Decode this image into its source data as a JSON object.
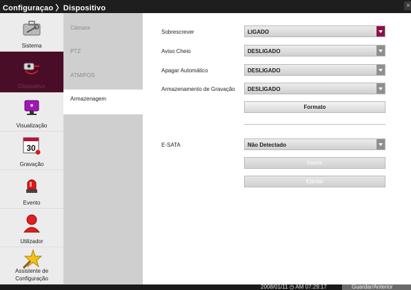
{
  "window": {
    "title": "Configuraçao 〉Dispositivo",
    "close_glyph": "×"
  },
  "sidebar": {
    "items": [
      {
        "label": "Sistema",
        "icon": "toolbox-icon"
      },
      {
        "label": "Dispositivo",
        "icon": "camera-plug-icon",
        "active": true
      },
      {
        "label": "Visualização",
        "icon": "monitor-icon"
      },
      {
        "label": "Gravação",
        "icon": "calendar-icon",
        "calendar_day": "30"
      },
      {
        "label": "Evento",
        "icon": "alarm-siren-icon"
      },
      {
        "label": "Utilizador",
        "icon": "user-icon"
      },
      {
        "label_line1": "Assistente de",
        "label_line2": "Configuração",
        "icon": "wizard-star-icon"
      }
    ]
  },
  "subnav": {
    "items": [
      {
        "label": "Câmara"
      },
      {
        "label": "PTZ"
      },
      {
        "label": "ATM/POS"
      },
      {
        "label": "Armazenagem",
        "active": true
      }
    ]
  },
  "settings": {
    "overwrite": {
      "label": "Sobrescrever",
      "value": "LIGADO"
    },
    "disk_full_warning": {
      "label": "Aviso Cheio",
      "value": "DESLIGADO"
    },
    "auto_delete": {
      "label": "Apagar Automático",
      "value": "DESLIGADO"
    },
    "recording_storage": {
      "label": "Armazenamento de Gravação",
      "value": "DESLIGADO"
    },
    "format_button": "Formato",
    "esata": {
      "label": "E-SATA",
      "value": "Não Detectado"
    },
    "insert_button": "Inserir",
    "eject_button": "Ejectar"
  },
  "statusbar": {
    "datetime": "2008/01/11 ◷ AM 07:29:17",
    "save_button": "Guardar/Anterior"
  },
  "colors": {
    "accent": "#8a1248",
    "active_sidebar_bg": "#4a0d28",
    "titlebar_bg": "#1e1e1e"
  }
}
